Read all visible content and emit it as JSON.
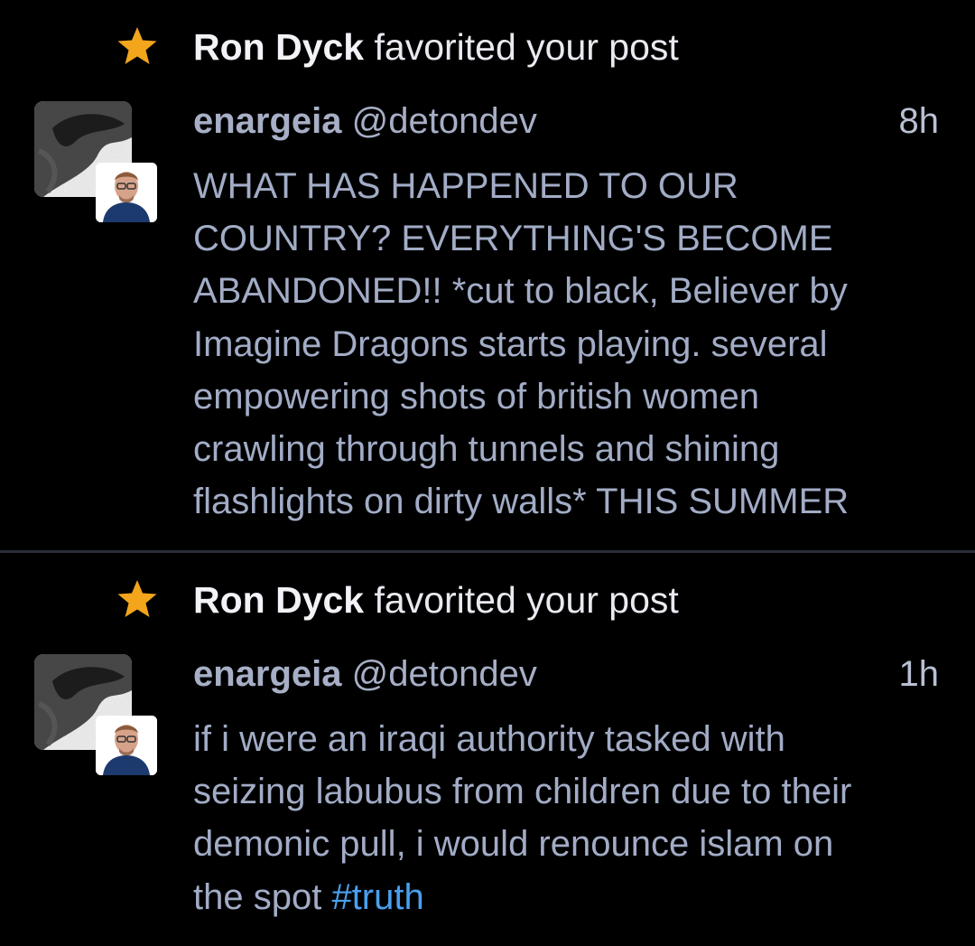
{
  "colors": {
    "background": "#000000",
    "star": "#f3a51c",
    "hashtag": "#4aa0ee",
    "body_text": "#a2acc6",
    "divider": "#2a2e38"
  },
  "notifications": [
    {
      "icon": "star-icon",
      "actor": "Ron Dyck",
      "action": " favorited your post",
      "post": {
        "display_name": "enargeia",
        "handle": " @detondev",
        "time": "8h",
        "body": "WHAT HAS HAPPENED TO OUR\nCOUNTRY? EVERYTHING'S BECOME\nABANDONED!! *cut to black, Believer by\nImagine Dragons starts playing. several\nempowering shots of british women\ncrawling through tunnels and shining\nflashlights on dirty walls* THIS SUMMER"
      }
    },
    {
      "icon": "star-icon",
      "actor": "Ron Dyck",
      "action": " favorited your post",
      "post": {
        "display_name": "enargeia",
        "handle": " @detondev",
        "time": "1h",
        "body": "if i were an iraqi authority tasked with\nseizing labubus from children due to their\ndemonic pull, i would renounce islam on\nthe spot ",
        "hashtag": "#truth"
      }
    }
  ]
}
